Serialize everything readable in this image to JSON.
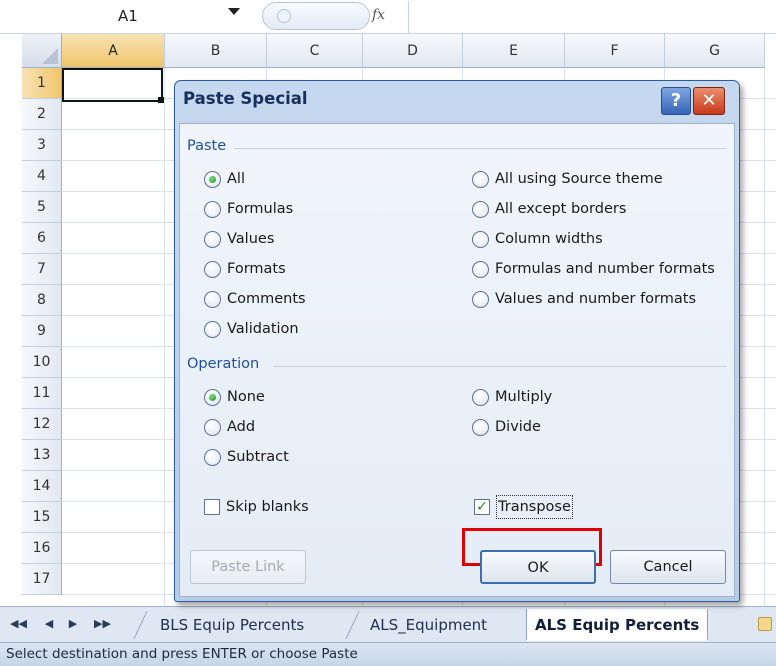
{
  "formula_bar": {
    "name_box": "A1",
    "fx_symbol": "fx"
  },
  "grid": {
    "columns": [
      "A",
      "B",
      "C",
      "D",
      "E",
      "F",
      "G"
    ],
    "rows": [
      "1",
      "2",
      "3",
      "4",
      "5",
      "6",
      "7",
      "8",
      "9",
      "10",
      "11",
      "12",
      "13",
      "14",
      "15",
      "16",
      "17"
    ],
    "active_cell": "A1"
  },
  "dialog": {
    "title": "Paste Special",
    "help_label": "?",
    "close_label": "✕",
    "paste_group": {
      "label": "Paste",
      "options_left": [
        "All",
        "Formulas",
        "Values",
        "Formats",
        "Comments",
        "Validation"
      ],
      "options_right": [
        "All using Source theme",
        "All except borders",
        "Column widths",
        "Formulas and number formats",
        "Values and number formats"
      ],
      "selected": "All"
    },
    "operation_group": {
      "label": "Operation",
      "options_left": [
        "None",
        "Add",
        "Subtract"
      ],
      "options_right": [
        "Multiply",
        "Divide"
      ],
      "selected": "None"
    },
    "skip_blanks": {
      "label": "Skip blanks",
      "checked": false
    },
    "transpose": {
      "label": "Transpose",
      "checked": true,
      "check_mark": "✓"
    },
    "buttons": {
      "paste_link": "Paste Link",
      "ok": "OK",
      "cancel": "Cancel"
    }
  },
  "sheet_tabs": {
    "nav": [
      "◀◀",
      "◀",
      "▶",
      "▶▶"
    ],
    "tabs": [
      "BLS Equip Percents",
      "ALS_Equipment",
      "ALS Equip Percents"
    ],
    "active_tab": "ALS Equip Percents"
  },
  "status_bar": {
    "message": "Select destination and press ENTER or choose Paste"
  },
  "colors": {
    "highlight_border": "#e00000",
    "radio_selected": "#1b8f1b",
    "group_label": "#1f4fa0"
  }
}
